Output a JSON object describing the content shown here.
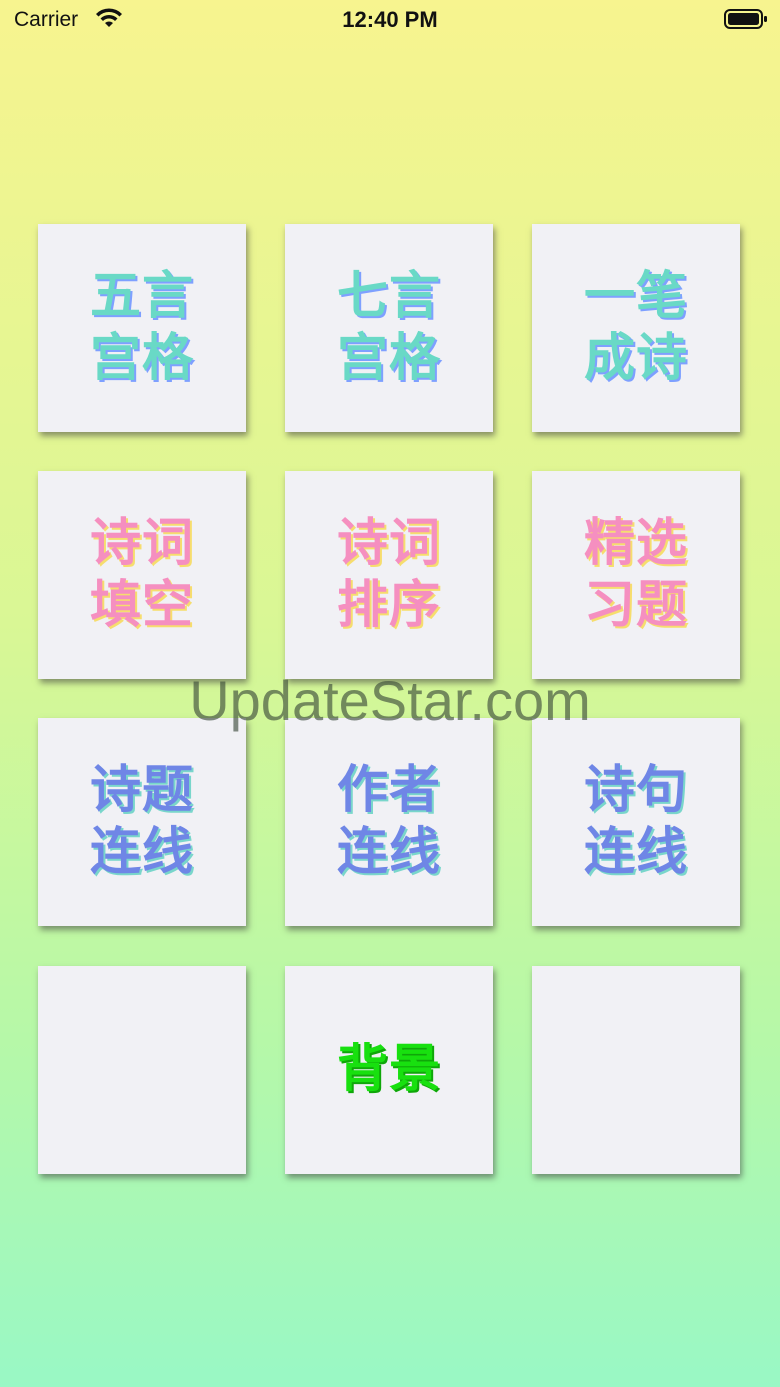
{
  "status_bar": {
    "carrier": "Carrier",
    "time": "12:40 PM",
    "wifi_icon": "wifi-icon",
    "battery_icon": "battery-icon"
  },
  "grid": {
    "tiles": [
      {
        "label": "五言宫格",
        "color_group": "teal"
      },
      {
        "label": "七言宫格",
        "color_group": "teal"
      },
      {
        "label": "一笔成诗",
        "color_group": "teal"
      },
      {
        "label": "诗词填空",
        "color_group": "pink"
      },
      {
        "label": "诗词排序",
        "color_group": "pink"
      },
      {
        "label": "精选习题",
        "color_group": "pink"
      },
      {
        "label": "诗题连线",
        "color_group": "blue"
      },
      {
        "label": "作者连线",
        "color_group": "blue"
      },
      {
        "label": "诗句连线",
        "color_group": "blue"
      },
      {
        "label": "",
        "color_group": "empty"
      },
      {
        "label": "背景",
        "color_group": "green"
      },
      {
        "label": "",
        "color_group": "empty"
      }
    ]
  },
  "watermark": "UpdateStar.com",
  "colors": {
    "teal": "#69d9c6",
    "pink": "#f58fc0",
    "blue": "#6f86e6",
    "green": "#18e00f",
    "tile_bg": "#f1f1f5"
  }
}
